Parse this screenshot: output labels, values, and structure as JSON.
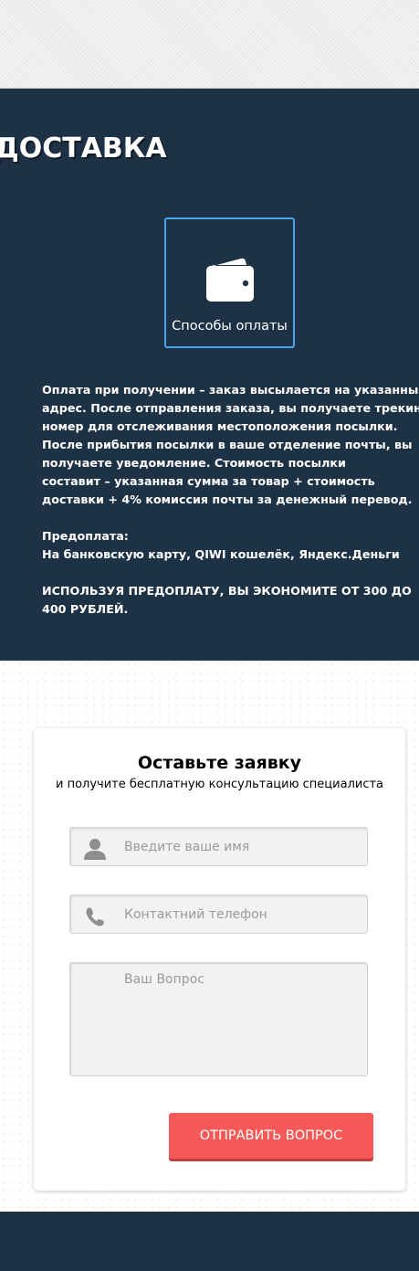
{
  "delivery": {
    "title": "ДОСТАВКА",
    "payment_tile_label": "Способы оплаты",
    "payment_tile_icon": "wallet-icon",
    "info_lines": [
      "Оплата при получении – заказ высылается на указанный",
      "адрес. После отправления заказа, вы получаете трекинг",
      "номер для отслеживания местоположения посылки.",
      "После прибытия посылки в ваше отделение почты, вы",
      "получаете уведомление. Стоимость посылки",
      "составит – указанная сумма за товар + стоимость",
      "доставки + 4% комиссия почты за денежный перевод."
    ],
    "prepay_label": "Предоплата:",
    "prepay_methods": "На банковскую карту, QIWI кошелёк, Яндекс.Деньги",
    "savings_lines": [
      "ИСПОЛЬЗУЯ ПРЕДОПЛАТУ, ВЫ ЭКОНОМИТЕ ОТ 300 ДО",
      "400 РУБЛЕЙ."
    ]
  },
  "form": {
    "title": "Оставьте заявку",
    "subtitle": "и получите бесплатную консультацию специалиста",
    "name_placeholder": "Введите ваше имя",
    "name_value": "",
    "phone_placeholder": "Контактний телефон",
    "phone_value": "",
    "question_placeholder": "Ваш Вопрос",
    "question_value": "",
    "submit_label": "ОТПРАВИТЬ ВОПРОС",
    "icons": [
      "user-icon",
      "phone-icon"
    ]
  },
  "colors": {
    "dark_blue": "#1e3246",
    "tile_border": "#4aa6ec",
    "submit": "#f65a58"
  }
}
